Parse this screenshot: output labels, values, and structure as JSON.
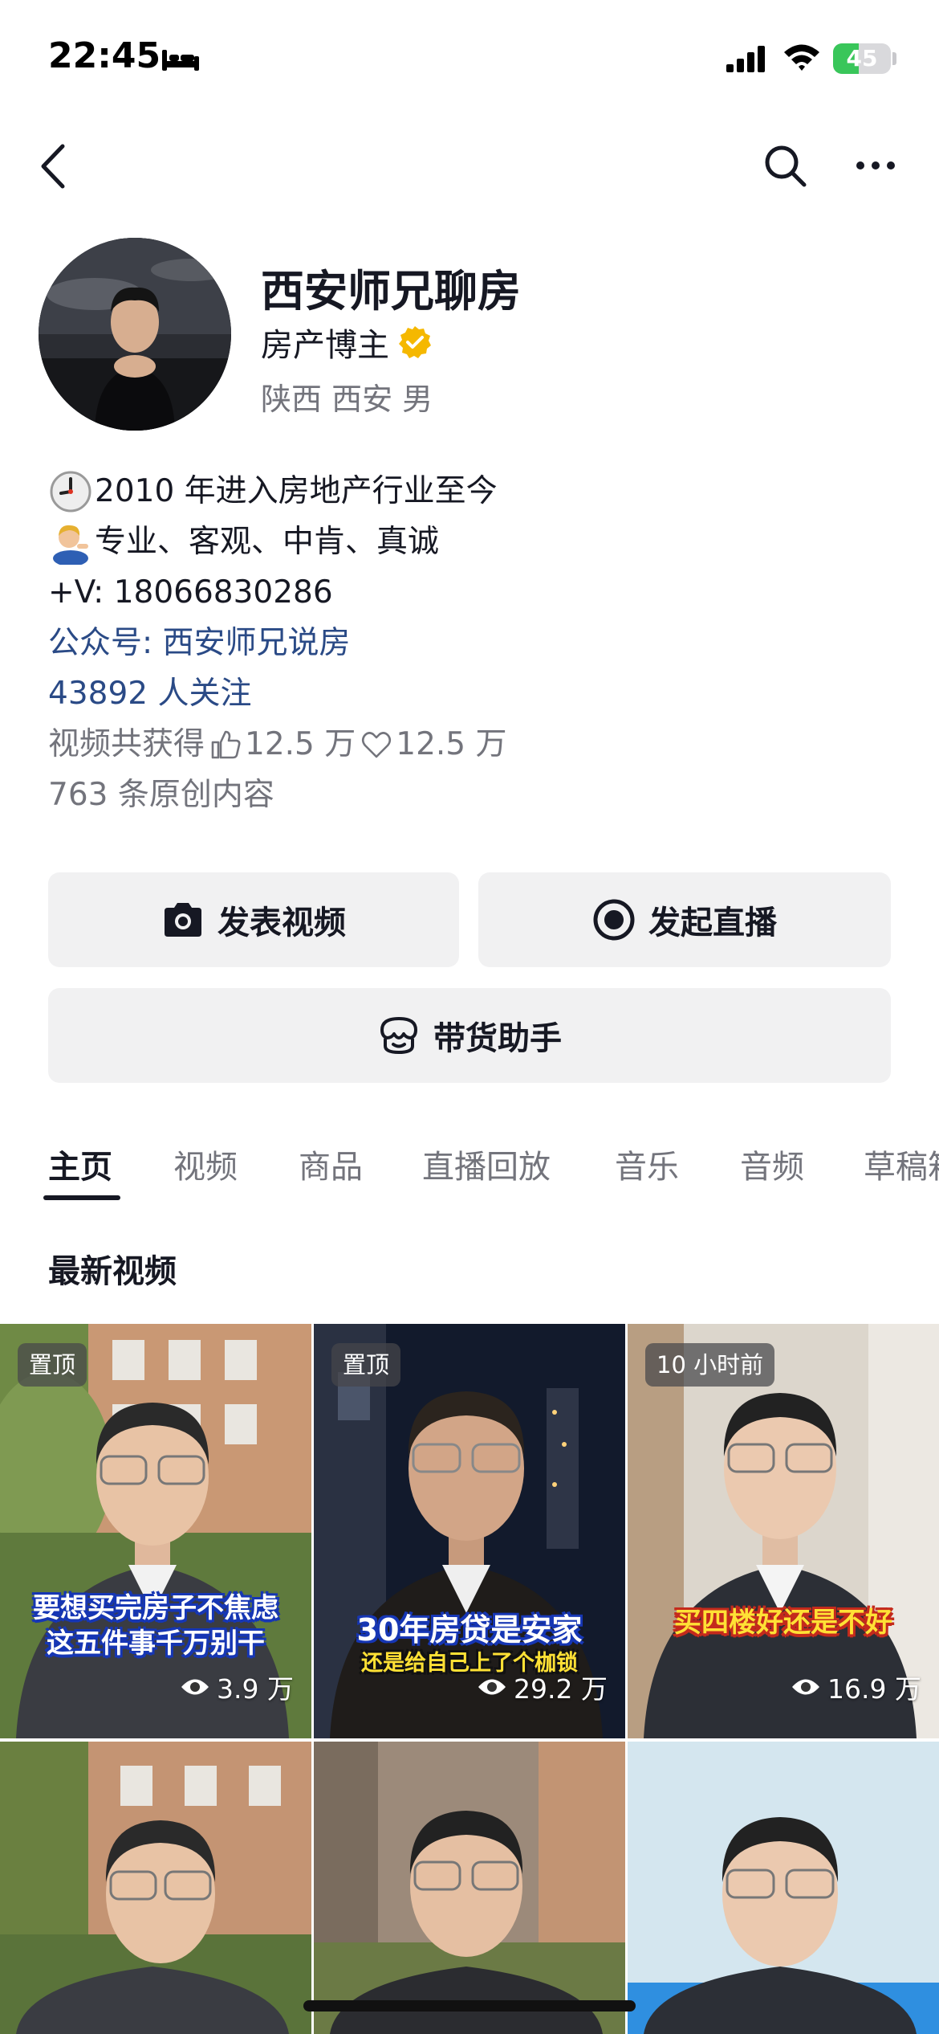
{
  "status_bar": {
    "time": "22:45",
    "battery_text": "45",
    "battery_level": 0.45
  },
  "profile": {
    "name": "西安师兄聊房",
    "role": "房产博主",
    "location": "陕西 西安 男",
    "bio": {
      "line1": "2010 年进入房地产行业至今",
      "line2": "专业、客观、中肯、真诚",
      "line3": "+V: 18066830286",
      "line4": "公众号: 西安师兄说房"
    },
    "followers": "43892 人关注",
    "stats": {
      "prefix": "视频共获得",
      "likes": "12.5 万",
      "favorites": "12.5 万"
    },
    "original_content": "763 条原创内容"
  },
  "actions": {
    "publish_video": "发表视频",
    "start_live": "发起直播",
    "sales_assistant": "带货助手"
  },
  "tabs": [
    "主页",
    "视频",
    "商品",
    "直播回放",
    "音乐",
    "音频",
    "草稿箱"
  ],
  "section_title": "最新视频",
  "videos": [
    {
      "badge": "置顶",
      "caption1": "要想买完房子不焦虑",
      "caption2": "这五件事千万别干",
      "views": "3.9 万"
    },
    {
      "badge": "置顶",
      "caption1": "30年房贷是安家",
      "caption2": "还是给自己上了个枷锁",
      "views": "29.2 万"
    },
    {
      "badge": "10 小时前",
      "caption1": "买四楼好还是不好",
      "views": "16.9 万"
    }
  ],
  "colors": {
    "accent_blue": "#2a4a86",
    "secondary_text": "#73747c",
    "button_bg": "#f1f1f2",
    "verified": "#f5b800"
  }
}
